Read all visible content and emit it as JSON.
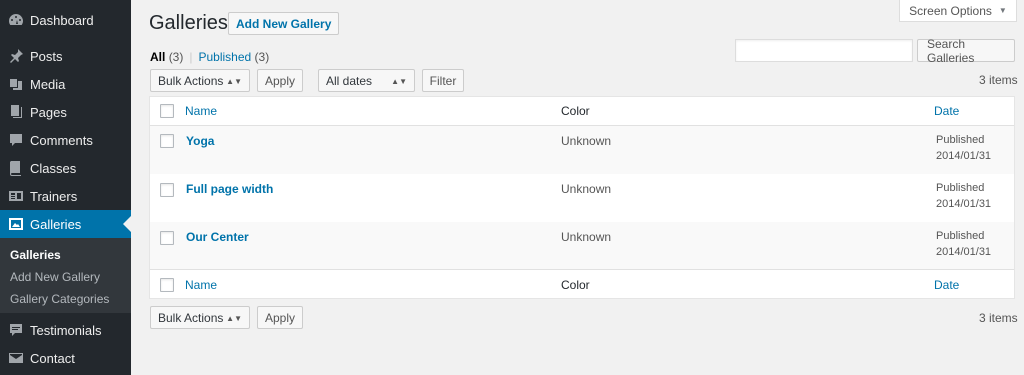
{
  "sidebar": {
    "items": [
      {
        "label": "Dashboard",
        "icon": "dashboard-icon"
      },
      {
        "label": "Posts",
        "icon": "pin-icon"
      },
      {
        "label": "Media",
        "icon": "media-icon"
      },
      {
        "label": "Pages",
        "icon": "pages-icon"
      },
      {
        "label": "Comments",
        "icon": "comment-icon"
      },
      {
        "label": "Classes",
        "icon": "book-icon"
      },
      {
        "label": "Trainers",
        "icon": "id-card-icon"
      },
      {
        "label": "Galleries",
        "icon": "gallery-icon"
      },
      {
        "label": "Testimonials",
        "icon": "testimonial-icon"
      },
      {
        "label": "Contact",
        "icon": "mail-icon"
      }
    ],
    "submenu": [
      "Galleries",
      "Add New Gallery",
      "Gallery Categories"
    ]
  },
  "header": {
    "screen_options": "Screen Options",
    "title": "Galleries",
    "add_new": "Add New Gallery"
  },
  "views": {
    "all_label": "All",
    "all_count": "(3)",
    "published_label": "Published",
    "published_count": "(3)",
    "separator": "|"
  },
  "search": {
    "value": "",
    "button": "Search Galleries"
  },
  "tablenav_top": {
    "bulk": "Bulk Actions",
    "apply": "Apply",
    "dates": "All dates",
    "filter": "Filter",
    "count": "3 items"
  },
  "tablenav_bottom": {
    "bulk": "Bulk Actions",
    "apply": "Apply",
    "count": "3 items"
  },
  "table": {
    "columns": {
      "name": "Name",
      "color": "Color",
      "date": "Date"
    },
    "rows": [
      {
        "name": "Yoga",
        "color": "Unknown",
        "status": "Published",
        "date": "2014/01/31"
      },
      {
        "name": "Full page width",
        "color": "Unknown",
        "status": "Published",
        "date": "2014/01/31"
      },
      {
        "name": "Our Center",
        "color": "Unknown",
        "status": "Published",
        "date": "2014/01/31"
      }
    ]
  },
  "colors": {
    "sidebar_bg": "#23282d",
    "accent": "#0073aa",
    "submenu_bg": "#32373c",
    "page_bg": "#f1f1f1"
  }
}
